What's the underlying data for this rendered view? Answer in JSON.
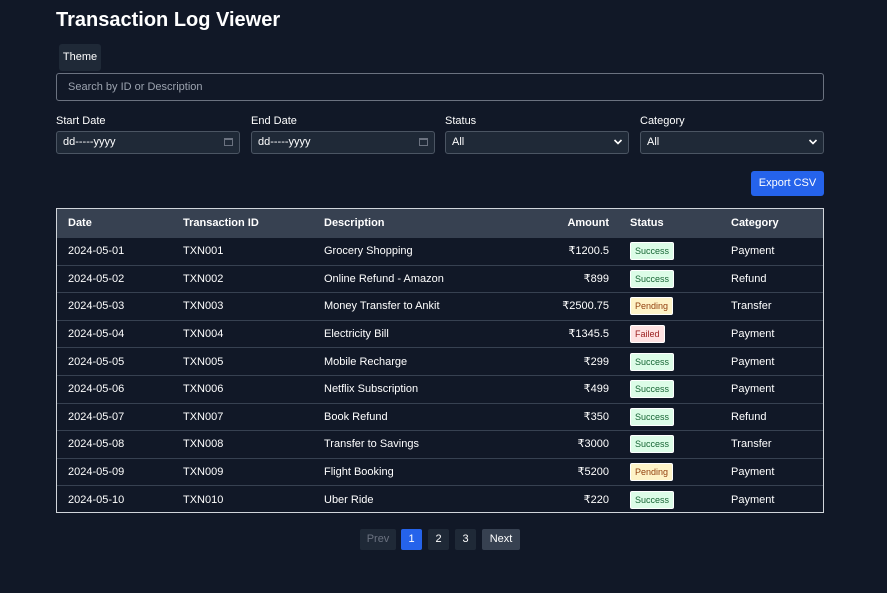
{
  "app": {
    "title": "Transaction Log Viewer",
    "theme_label": "Theme"
  },
  "search": {
    "placeholder": "Search by ID or Description",
    "value": ""
  },
  "filters": {
    "start_date": {
      "label": "Start Date",
      "value": "dd-----yyyy"
    },
    "end_date": {
      "label": "End Date",
      "value": "dd-----yyyy"
    },
    "status": {
      "label": "Status",
      "value": "All"
    },
    "category": {
      "label": "Category",
      "value": "All"
    }
  },
  "actions": {
    "export_label": "Export CSV"
  },
  "table": {
    "headers": {
      "date": "Date",
      "id": "Transaction ID",
      "description": "Description",
      "amount": "Amount",
      "status": "Status",
      "category": "Category"
    },
    "rows": [
      {
        "date": "2024-05-01",
        "id": "TXN001",
        "description": "Grocery Shopping",
        "amount": "₹1200.5",
        "status": "Success",
        "category": "Payment"
      },
      {
        "date": "2024-05-02",
        "id": "TXN002",
        "description": "Online Refund - Amazon",
        "amount": "₹899",
        "status": "Success",
        "category": "Refund"
      },
      {
        "date": "2024-05-03",
        "id": "TXN003",
        "description": "Money Transfer to Ankit",
        "amount": "₹2500.75",
        "status": "Pending",
        "category": "Transfer"
      },
      {
        "date": "2024-05-04",
        "id": "TXN004",
        "description": "Electricity Bill",
        "amount": "₹1345.5",
        "status": "Failed",
        "category": "Payment"
      },
      {
        "date": "2024-05-05",
        "id": "TXN005",
        "description": "Mobile Recharge",
        "amount": "₹299",
        "status": "Success",
        "category": "Payment"
      },
      {
        "date": "2024-05-06",
        "id": "TXN006",
        "description": "Netflix Subscription",
        "amount": "₹499",
        "status": "Success",
        "category": "Payment"
      },
      {
        "date": "2024-05-07",
        "id": "TXN007",
        "description": "Book Refund",
        "amount": "₹350",
        "status": "Success",
        "category": "Refund"
      },
      {
        "date": "2024-05-08",
        "id": "TXN008",
        "description": "Transfer to Savings",
        "amount": "₹3000",
        "status": "Success",
        "category": "Transfer"
      },
      {
        "date": "2024-05-09",
        "id": "TXN009",
        "description": "Flight Booking",
        "amount": "₹5200",
        "status": "Pending",
        "category": "Payment"
      },
      {
        "date": "2024-05-10",
        "id": "TXN010",
        "description": "Uber Ride",
        "amount": "₹220",
        "status": "Success",
        "category": "Payment"
      }
    ]
  },
  "pagination": {
    "prev_label": "Prev",
    "next_label": "Next",
    "pages": [
      "1",
      "2",
      "3"
    ],
    "current_page": "1"
  },
  "colors": {
    "background": "#111827",
    "accent": "#2563eb",
    "success_bg": "#dcfce7",
    "pending_bg": "#fef3c7",
    "failed_bg": "#fee2e2"
  },
  "icons": {
    "date_picker": "calendar-icon",
    "select": "chevron-down-icon"
  }
}
